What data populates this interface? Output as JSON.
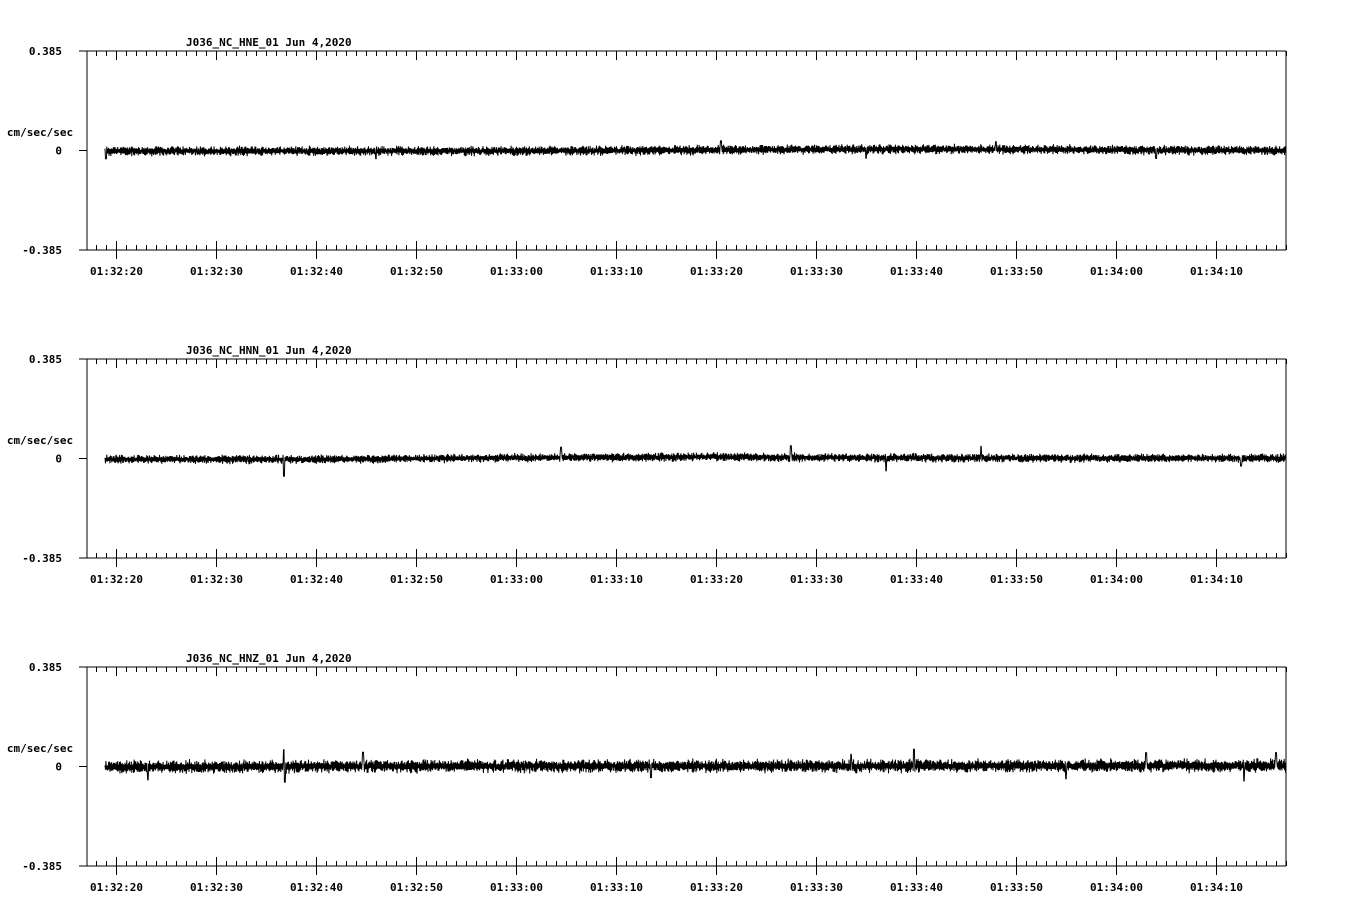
{
  "chart_data": [
    {
      "type": "line",
      "title": "J036_NC_HNE_01   Jun 4,2020",
      "ylabel": "cm/sec/sec",
      "ylim": [
        -0.385,
        0.385
      ],
      "yticks": [
        {
          "value": 0.385,
          "label": "0.385"
        },
        {
          "value": 0,
          "label": "0"
        },
        {
          "value": -0.385,
          "label": "-0.385"
        }
      ],
      "x_labels": [
        "01:32:20",
        "01:32:30",
        "01:32:40",
        "01:32:50",
        "01:33:00",
        "01:33:10",
        "01:33:20",
        "01:33:30",
        "01:33:40",
        "01:33:50",
        "01:34:00",
        "01:34:10"
      ],
      "x_range_seconds": [
        -2.9,
        117
      ],
      "signal_start_seconds": -1.1,
      "series": [
        {
          "name": "",
          "trend": [
            [
              0,
              -0.002
            ],
            [
              40,
              -0.002
            ],
            [
              60,
              0.002
            ],
            [
              80,
              0.006
            ],
            [
              100,
              0.002
            ],
            [
              117,
              0
            ]
          ],
          "noise_amplitude": 0.022,
          "spikes": [
            [
              -1.0,
              -0.03
            ],
            [
              26.0,
              -0.03
            ],
            [
              60.5,
              0.035
            ],
            [
              75.0,
              -0.035
            ],
            [
              88.0,
              0.03
            ],
            [
              104.0,
              -0.032
            ]
          ]
        }
      ]
    },
    {
      "type": "line",
      "title": "J036_NC_HNN_01   Jun 4,2020",
      "ylabel": "cm/sec/sec",
      "ylim": [
        -0.385,
        0.385
      ],
      "yticks": [
        {
          "value": 0.385,
          "label": "0.385"
        },
        {
          "value": 0,
          "label": "0"
        },
        {
          "value": -0.385,
          "label": "-0.385"
        }
      ],
      "x_labels": [
        "01:32:20",
        "01:32:30",
        "01:32:40",
        "01:32:50",
        "01:33:00",
        "01:33:10",
        "01:33:20",
        "01:33:30",
        "01:33:40",
        "01:33:50",
        "01:34:00",
        "01:34:10"
      ],
      "x_range_seconds": [
        -2.9,
        117
      ],
      "signal_start_seconds": -1.1,
      "series": [
        {
          "name": "",
          "trend": [
            [
              0,
              -0.003
            ],
            [
              20,
              -0.003
            ],
            [
              45,
              0.004
            ],
            [
              60,
              0.006
            ],
            [
              80,
              0.002
            ],
            [
              117,
              0.001
            ]
          ],
          "noise_amplitude": 0.02,
          "spikes": [
            [
              16.8,
              -0.065
            ],
            [
              44.5,
              0.04
            ],
            [
              67.5,
              0.045
            ],
            [
              77.0,
              -0.05
            ],
            [
              86.5,
              0.045
            ],
            [
              112.5,
              -0.03
            ]
          ]
        }
      ]
    },
    {
      "type": "line",
      "title": "J036_NC_HNZ_01   Jun 4,2020",
      "ylabel": "cm/sec/sec",
      "ylim": [
        -0.385,
        0.385
      ],
      "yticks": [
        {
          "value": 0.385,
          "label": "0.385"
        },
        {
          "value": 0,
          "label": "0"
        },
        {
          "value": -0.385,
          "label": "-0.385"
        }
      ],
      "x_labels": [
        "01:32:20",
        "01:32:30",
        "01:32:40",
        "01:32:50",
        "01:33:00",
        "01:33:10",
        "01:33:20",
        "01:33:30",
        "01:33:40",
        "01:33:50",
        "01:34:00",
        "01:34:10"
      ],
      "x_range_seconds": [
        -2.9,
        117
      ],
      "signal_start_seconds": -1.1,
      "series": [
        {
          "name": "",
          "trend": [
            [
              0,
              -0.002
            ],
            [
              40,
              0.002
            ],
            [
              80,
              0.002
            ],
            [
              117,
              0.004
            ]
          ],
          "noise_amplitude": 0.03,
          "spikes": [
            [
              3.2,
              -0.05
            ],
            [
              16.8,
              0.065
            ],
            [
              16.9,
              -0.06
            ],
            [
              24.7,
              0.055
            ],
            [
              53.5,
              -0.045
            ],
            [
              73.5,
              0.045
            ],
            [
              79.8,
              0.065
            ],
            [
              95.0,
              -0.05
            ],
            [
              103.0,
              0.05
            ],
            [
              112.8,
              -0.06
            ],
            [
              116.0,
              0.05
            ]
          ]
        }
      ]
    }
  ]
}
